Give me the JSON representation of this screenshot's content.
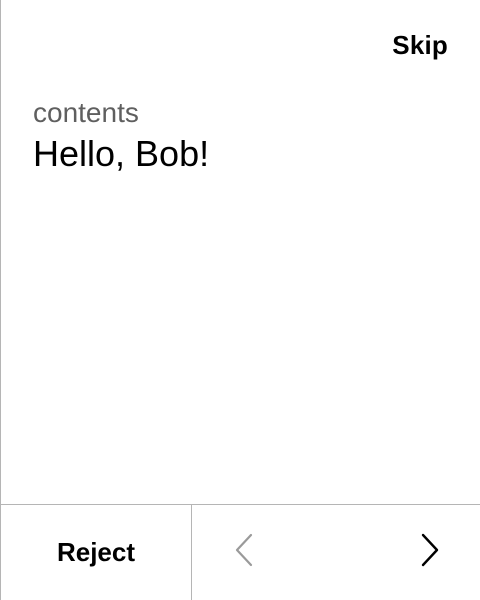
{
  "header": {
    "skip_label": "Skip"
  },
  "content": {
    "label": "contents",
    "message": "Hello, Bob!"
  },
  "footer": {
    "reject_label": "Reject",
    "prev_icon": "chevron-left-icon",
    "next_icon": "chevron-right-icon"
  },
  "colors": {
    "text": "#000000",
    "label": "#5f5f5f",
    "disabled_icon": "#9a9a9a",
    "divider": "#b5b5b5"
  }
}
